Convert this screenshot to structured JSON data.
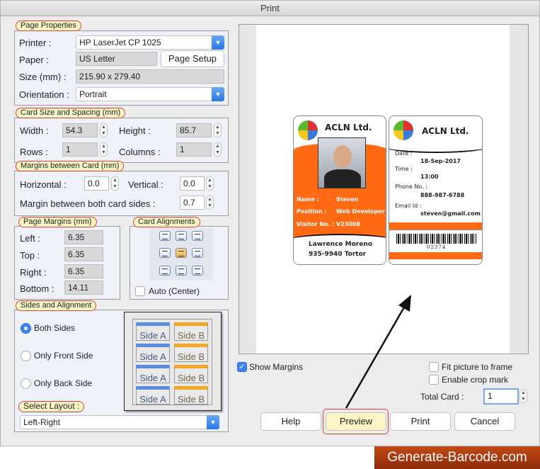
{
  "window": {
    "title": "Print"
  },
  "page_properties": {
    "legend": "Page Properties",
    "printer_label": "Printer :",
    "printer_value": "HP LaserJet CP 1025",
    "paper_label": "Paper :",
    "paper_value": "US Letter",
    "page_setup_button": "Page Setup",
    "size_label": "Size (mm) :",
    "size_value": "215.90 x 279.40",
    "orientation_label": "Orientation :",
    "orientation_value": "Portrait"
  },
  "card_size": {
    "legend": "Card Size and Spacing (mm)",
    "width_label": "Width :",
    "width_value": "54.3",
    "height_label": "Height :",
    "height_value": "85.7",
    "rows_label": "Rows :",
    "rows_value": "1",
    "columns_label": "Columns :",
    "columns_value": "1"
  },
  "margins_between": {
    "legend": "Margins between Card (mm)",
    "horizontal_label": "Horizontal :",
    "horizontal_value": "0.0",
    "vertical_label": "Vertical :",
    "vertical_value": "0.0",
    "both_sides_label": "Margin between both card sides :",
    "both_sides_value": "0.7"
  },
  "page_margins": {
    "legend": "Page Margins (mm)",
    "left_label": "Left :",
    "left_value": "6.35",
    "top_label": "Top :",
    "top_value": "6.35",
    "right_label": "Right :",
    "right_value": "6.35",
    "bottom_label": "Bottom :",
    "bottom_value": "14.11"
  },
  "card_alignments": {
    "legend": "Card Alignments",
    "selected": "middle-center",
    "auto_label": "Auto (Center)",
    "auto_checked": false
  },
  "sides": {
    "legend": "Sides and Alignment",
    "options": [
      "Both Sides",
      "Only Front Side",
      "Only Back Side"
    ],
    "selected": "Both Sides",
    "layout_tiles": [
      "Side A",
      "Side B"
    ],
    "select_layout_label": "Select Layout :",
    "layout_value": "Left-Right"
  },
  "preview": {
    "front": {
      "company": "ACLN Ltd.",
      "name_label": "Name :",
      "name_value": "Steven",
      "position_label": "Position :",
      "position_value": "Web Developer",
      "visitor_label": "Visitor No. :",
      "visitor_value": "V23008",
      "footer_line1": "Lawrence Moreno",
      "footer_line2": "935-9940 Tortor"
    },
    "back": {
      "company": "ACLN Ltd.",
      "date_label": "Date :",
      "date_value": "18-Sep-2017",
      "time_label": "Time :",
      "time_value": "13:00",
      "phone_label": "Phone No. :",
      "phone_value": "888-987-6788",
      "email_label": "Email Id :",
      "email_value": "steven@gmail.com",
      "barcode_text": "02374"
    },
    "accent": "#ff6a13"
  },
  "options": {
    "show_margins_label": "Show Margins",
    "show_margins": true,
    "fit_label": "Fit picture to frame",
    "fit": false,
    "crop_label": "Enable crop mark",
    "crop": false,
    "total_card_label": "Total Card :",
    "total_card_value": "1"
  },
  "buttons": {
    "help": "Help",
    "preview": "Preview",
    "print": "Print",
    "cancel": "Cancel"
  },
  "watermark": "Generate-Barcode.com"
}
